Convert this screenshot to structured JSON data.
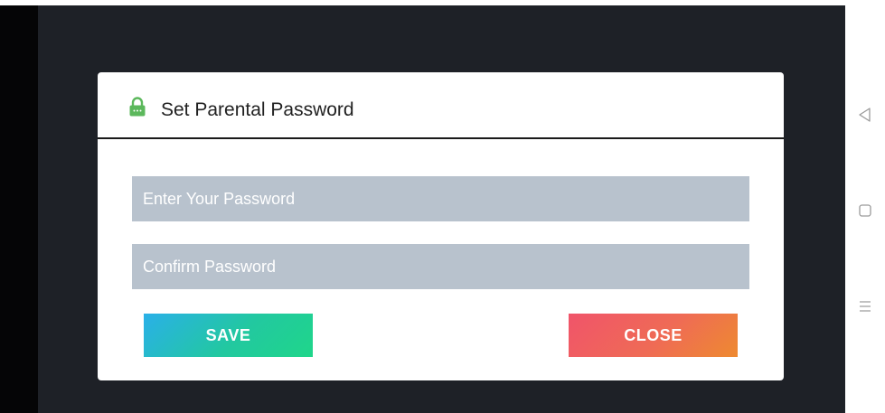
{
  "dialog": {
    "title": "Set Parental Password",
    "password_placeholder": "Enter Your Password",
    "confirm_placeholder": "Confirm Password",
    "save_label": "SAVE",
    "close_label": "CLOSE"
  },
  "colors": {
    "lock_green": "#5cb85c",
    "field_bg": "#b8c2cd",
    "save_gradient": [
      "#2ab0e8",
      "#1fd68a"
    ],
    "close_gradient": [
      "#f0546a",
      "#ee8a30"
    ],
    "backdrop": "#1e2127"
  },
  "icons": {
    "header": "lock-icon",
    "nav": [
      "back-triangle-icon",
      "home-square-icon",
      "menu-lines-icon"
    ]
  }
}
